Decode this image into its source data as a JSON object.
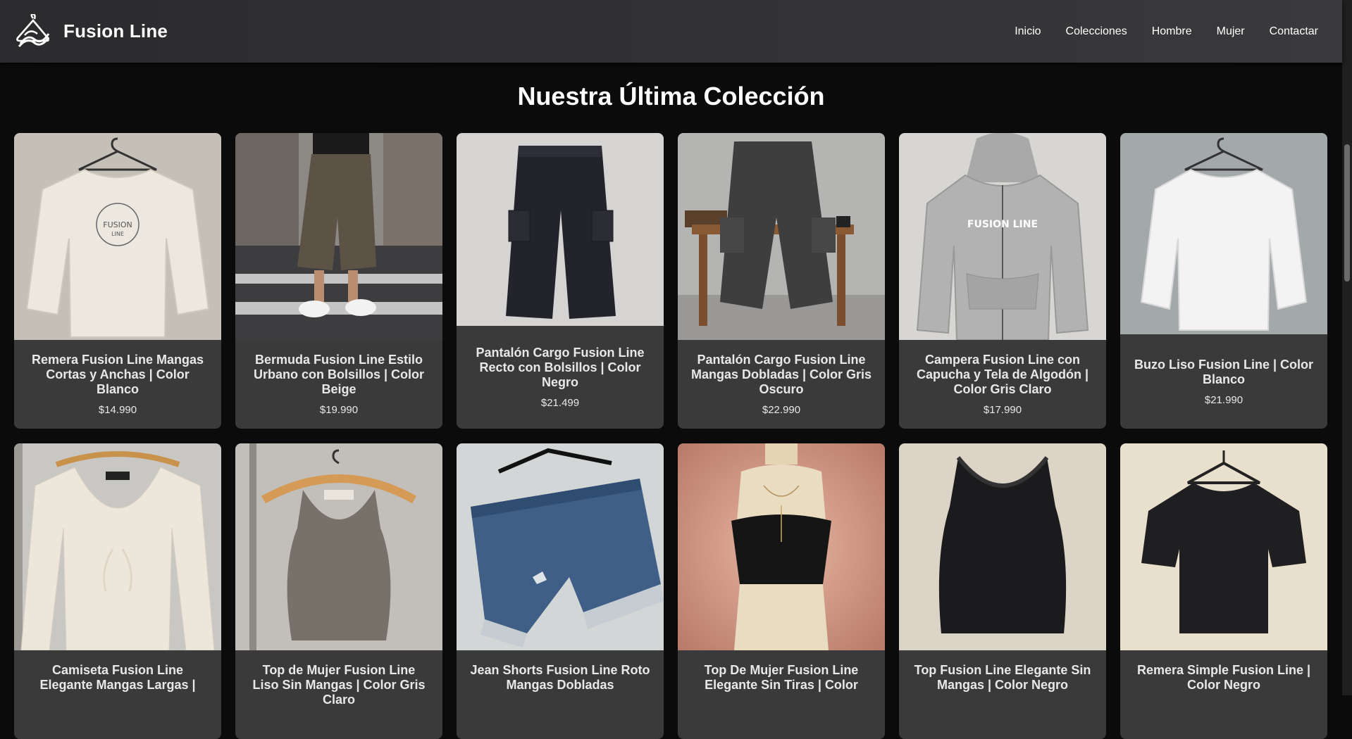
{
  "brand": {
    "name": "Fusion Line",
    "icon": "hanger-logo-icon"
  },
  "nav": {
    "items": [
      {
        "label": "Inicio"
      },
      {
        "label": "Colecciones"
      },
      {
        "label": "Hombre"
      },
      {
        "label": "Mujer"
      },
      {
        "label": "Contactar"
      }
    ]
  },
  "section": {
    "title": "Nuestra Última Colección"
  },
  "products": [
    {
      "title": "Remera Fusion Line Mangas Cortas y Anchas | Color Blanco",
      "price": "$14.990",
      "image": "white-oversized-tshirt"
    },
    {
      "title": "Bermuda Fusion Line Estilo Urbano con Bolsillos | Color Beige",
      "price": "$19.990",
      "image": "cargo-bermuda-street"
    },
    {
      "title": "Pantalón Cargo Fusion Line Recto con Bolsillos | Color Negro",
      "price": "$21.499",
      "image": "black-cargo-pants"
    },
    {
      "title": "Pantalón Cargo Fusion Line Mangas Dobladas | Color Gris Oscuro",
      "price": "$22.990",
      "image": "grey-cargo-pants-on-stool"
    },
    {
      "title": "Campera Fusion Line con Capucha y Tela de Algodón | Color Gris Claro",
      "price": "$17.990",
      "image": "grey-zip-hoodie"
    },
    {
      "title": "Buzo Liso Fusion Line | Color Blanco",
      "price": "$21.990",
      "image": "white-sweatshirt"
    },
    {
      "title": "Camiseta Fusion Line Elegante Mangas Largas |",
      "price": "",
      "image": "cream-long-sleeve-top"
    },
    {
      "title": "Top de Mujer Fusion Line Liso Sin Mangas | Color Gris Claro",
      "price": "",
      "image": "grey-tank-top"
    },
    {
      "title": "Jean Shorts Fusion Line Roto Mangas Dobladas",
      "price": "",
      "image": "denim-shorts"
    },
    {
      "title": "Top De Mujer Fusion Line Elegante Sin Tiras | Color",
      "price": "",
      "image": "strapless-black-top"
    },
    {
      "title": "Top Fusion Line Elegante Sin Mangas | Color Negro",
      "price": "",
      "image": "black-tank-top"
    },
    {
      "title": "Remera Simple Fusion Line | Color Negro",
      "price": "",
      "image": "black-tshirt"
    }
  ],
  "colors": {
    "header": "#333335",
    "background": "#0b0b0b",
    "card": "#3a3a3a",
    "text": "#ffffff"
  }
}
